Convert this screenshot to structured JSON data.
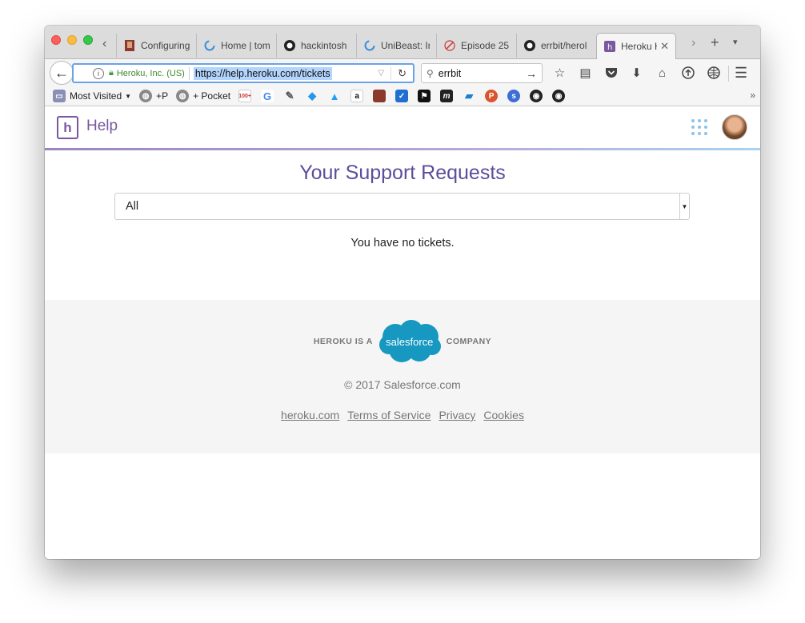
{
  "browser": {
    "tabs": [
      {
        "title": "Configuring",
        "icon": "portrait-favicon-icon"
      },
      {
        "title": "Home | tom",
        "icon": "loading-spinner-icon"
      },
      {
        "title": "hackintosh",
        "icon": "github-icon"
      },
      {
        "title": "UniBeast: In",
        "icon": "loading-spinner-icon"
      },
      {
        "title": "Episode 25",
        "icon": "pencil-icon"
      },
      {
        "title": "errbit/herol",
        "icon": "github-icon"
      },
      {
        "title": "Heroku He",
        "icon": "heroku-icon",
        "active": true
      }
    ],
    "identity": "Heroku, Inc. (US)",
    "url": "https://help.heroku.com/tickets",
    "search_query": "errbit",
    "bookmarks": {
      "most_visited": "Most Visited",
      "plus_p": "+P",
      "plus_pocket": "+ Pocket",
      "gmail_badge": "100+"
    }
  },
  "header": {
    "logo_letter": "h",
    "title": "Help"
  },
  "main": {
    "title": "Your Support Requests",
    "filter": {
      "selected": "All"
    },
    "empty_message": "You have no tickets."
  },
  "footer": {
    "heroku_is_a": "HEROKU IS A",
    "salesforce": "salesforce",
    "company": "COMPANY",
    "copyright": "© 2017 Salesforce.com",
    "links": [
      "heroku.com",
      "Terms of Service",
      "Privacy",
      "Cookies"
    ]
  },
  "colors": {
    "heroku_purple": "#79589f",
    "title_purple": "#5e4d9c",
    "salesforce_blue": "#1798c1",
    "selection_blue": "#b3d4fc"
  }
}
